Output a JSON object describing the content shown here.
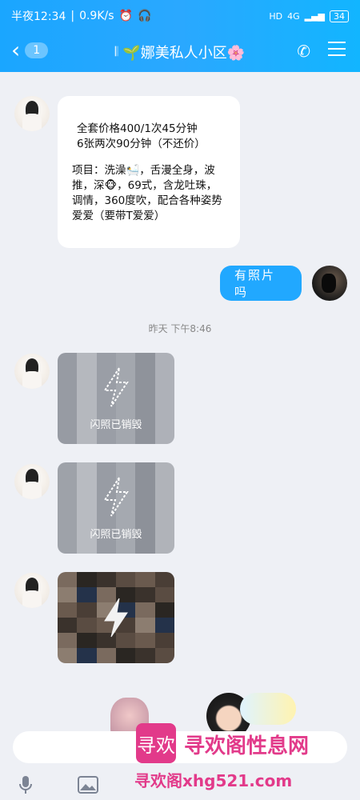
{
  "status_bar": {
    "time": "半夜12:34",
    "speed": "0.9K/s",
    "network": "4G",
    "battery": "34"
  },
  "header": {
    "back_badge": "1",
    "title": "🌱娜美私人小区🌸"
  },
  "messages": {
    "price_line1": "全套价格400/1次45分钟",
    "price_line2": "6张两次90分钟（不还价）",
    "items_text": "项目：洗澡🛀，舌漫全身，波推，深🐵，69式，含龙吐珠，调情，360度吹，配合各种姿势爱爱（要带T爱爱）",
    "my_message": "有照片吗",
    "timestamp": "昨天 下午8:46",
    "flash_label_1": "闪照已销毁",
    "flash_label_2": "闪照已销毁"
  },
  "watermark": {
    "logo": "寻欢",
    "name": "寻欢阁性息网",
    "url": "寻欢阁xhg521.com"
  },
  "colors": {
    "accent": "#21a8ff",
    "background": "#eef0f5",
    "watermark": "#e23a8a"
  },
  "icons": {
    "back": "chevron-left-icon",
    "phone": "phone-icon",
    "menu": "hamburger-icon",
    "voice": "microphone-icon",
    "image": "image-icon"
  }
}
